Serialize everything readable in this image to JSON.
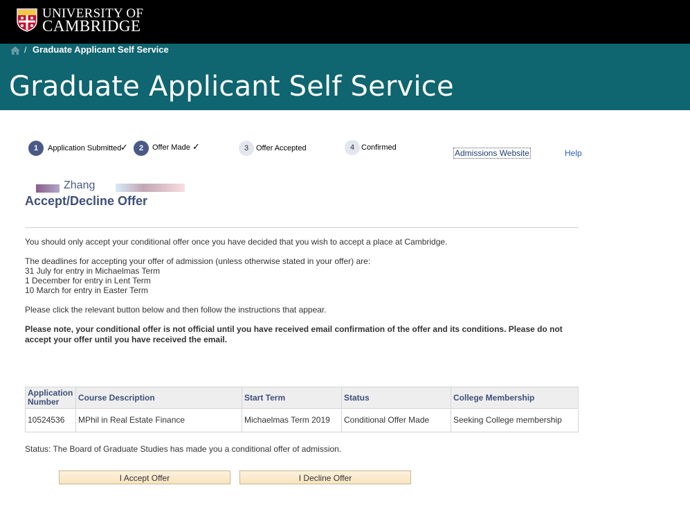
{
  "header": {
    "university_line1": "UNIVERSITY OF",
    "university_line2": "CAMBRIDGE",
    "breadcrumb": "Graduate Applicant Self Service",
    "breadcrumb_separator": "/",
    "banner_title": "Graduate Applicant Self Service",
    "band_color": "#0f6570"
  },
  "progress": {
    "steps": [
      {
        "number": "1",
        "label": "Application Submitted",
        "done": true
      },
      {
        "number": "2",
        "label": "Offer Made",
        "done": true
      },
      {
        "number": "3",
        "label": "Offer Accepted",
        "done": false
      },
      {
        "number": "4",
        "label": "Confirmed",
        "done": false
      }
    ],
    "check_glyph": "✓"
  },
  "links": {
    "admissions": "Admissions Website",
    "help": "Help"
  },
  "applicant": {
    "name": "Zhang"
  },
  "page_title": "Accept/Decline Offer",
  "content": {
    "intro": "You should only accept your conditional offer once you have decided that you wish to accept a place at Cambridge.",
    "deadlines_intro": "The deadlines for accepting your offer of admission (unless otherwise stated in your offer) are:",
    "deadline_1": "31 July for entry in Michaelmas Term",
    "deadline_2": "1 December for entry in Lent Term",
    "deadline_3": "10 March for entry in Easter Term",
    "instruction": "Please click the relevant button below and then follow the instructions that appear.",
    "note": "Please note, your conditional offer is not official until you have received email confirmation of the offer and its conditions. Please do not accept your offer until you have received the email."
  },
  "table": {
    "headers": [
      "Application Number",
      "Course Description",
      "Start Term",
      "Status",
      "College Membership"
    ],
    "rows": [
      [
        "10524536",
        "MPhil in Real Estate Finance",
        "Michaelmas Term 2019",
        "Conditional Offer Made",
        "Seeking College membership"
      ]
    ]
  },
  "status_line": "Status: The Board of Graduate Studies has made you a conditional offer of admission.",
  "buttons": {
    "accept": "I Accept Offer",
    "decline": "I Decline Offer"
  }
}
